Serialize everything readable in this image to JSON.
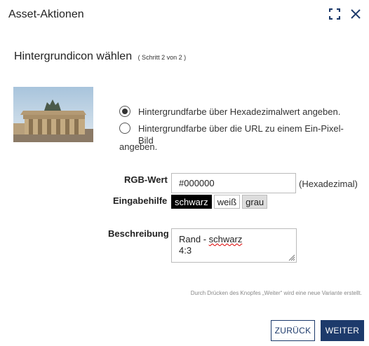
{
  "dialog": {
    "title": "Asset-Aktionen",
    "icons": [
      "expand-icon",
      "close-icon"
    ]
  },
  "step": {
    "title": "Hintergrundicon wählen",
    "subtitle": "( Schritt 2 von 2 )"
  },
  "options": [
    {
      "label": "Hintergrundfarbe über Hexadezimalwert angeben.",
      "checked": true
    },
    {
      "label": "Hintergrundfarbe über die URL zu einem Ein-Pixel-Bild",
      "label_cont": "angeben.",
      "checked": false
    }
  ],
  "form": {
    "rgb_label": "RGB-Wert",
    "rgb_value": "#000000",
    "rgb_suffix": "(Hexadezimal)",
    "help_label": "Eingabehilfe",
    "chips": [
      "schwarz",
      "weiß",
      "grau"
    ],
    "desc_label": "Beschreibung",
    "desc_line1_a": "Rand - ",
    "desc_line1_b": "schwarz",
    "desc_line2": "4:3"
  },
  "note": "Durch Drücken des Knopfes „Weiter“ wird eine neue Variante erstellt.",
  "buttons": {
    "back": "ZURÜCK",
    "next": "WEITER"
  },
  "colors": {
    "primary": "#1d3a6b",
    "chip_black": "#000000",
    "chip_gray": "#dddddd"
  }
}
